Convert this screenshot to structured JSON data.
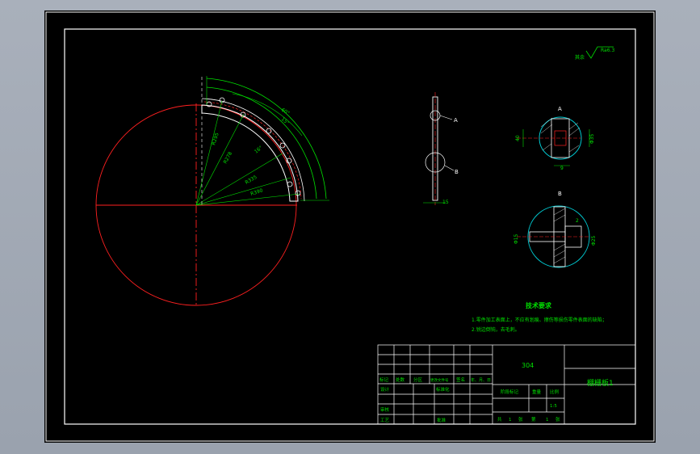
{
  "drawing": {
    "roughness_note": {
      "prefix": "其余",
      "symbol": "Ra6.3"
    },
    "dimensions": {
      "r_top": "R295",
      "r2": "R278",
      "r3": "R335",
      "r4": "R355",
      "r5": "R390",
      "ang_a": "16°",
      "ang_b": "60°",
      "ang_c": "15°",
      "detail_width": "15",
      "a_height": "40",
      "a_dia": "Φ35",
      "a_depth": "9",
      "b_dia": "Φ15",
      "b_dia2": "Φ25",
      "b_offset": "2"
    },
    "labels": {
      "detail_a": "A",
      "detail_b": "B"
    }
  },
  "technical": {
    "title": "技术要求",
    "items": [
      "1.零件加工表面上，不应有划痕、擦伤等损伤零件表面的缺陷；",
      "2.锐边倒钝，去毛刺。"
    ]
  },
  "title_block": {
    "material": "304",
    "part_name": "棚栅板1",
    "headers": {
      "mark": "标记",
      "count": "处数",
      "zone": "分区",
      "doc": "更改文件号",
      "sign": "签名",
      "date": "年、月、日"
    },
    "roles": {
      "design": "设计",
      "standard": "标准化",
      "review": "审核",
      "process": "工艺",
      "approve": "批准"
    },
    "stage_mark": "阶段标记",
    "weight": "重量",
    "scale": "比例",
    "scale_value": "1:5",
    "sheets": {
      "total_label": "共",
      "total": "1",
      "total_unit": "张",
      "page_label": "第",
      "page": "1",
      "page_unit": "张"
    }
  },
  "colors": {
    "bg": "#000000",
    "frame": "#ffffff",
    "green": "#00e000",
    "red": "#ff2020",
    "white": "#ffffff",
    "cyan": "#00c8d0"
  }
}
